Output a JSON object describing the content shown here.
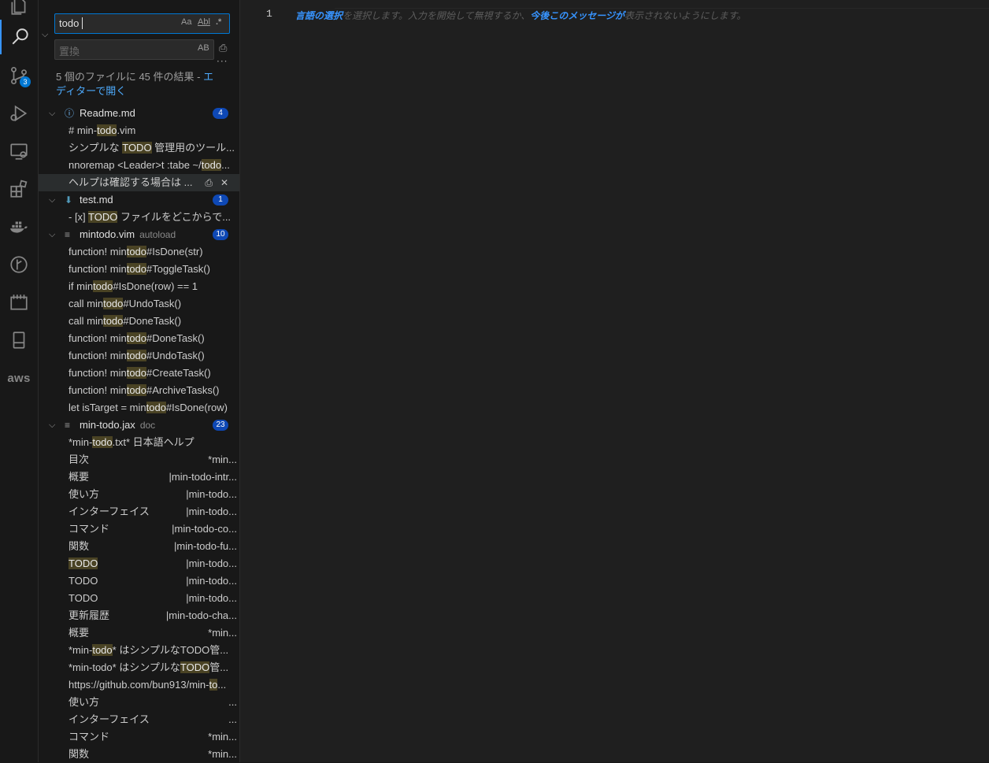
{
  "activity_bar": {
    "source_control_badge": "3",
    "aws_label": "aws"
  },
  "search": {
    "query": "todo",
    "replace_placeholder": "置換",
    "opt_case": "Aa",
    "opt_word": "Abl",
    "opt_regex": ".*",
    "opt_preserve_case": "AB",
    "summary_prefix": "5 個のファイルに 45 件の結果 - ",
    "summary_link": "エディターで開く"
  },
  "files": [
    {
      "name": "Readme.md",
      "dir": "",
      "count": "4",
      "matches": [
        {
          "pre": "# min-",
          "hl": "todo",
          "post": ".vim"
        },
        {
          "pre": "シンプルな ",
          "hl": "TODO",
          "post": " 管理用のツール..."
        },
        {
          "pre": "nnoremap <Leader>t :tabe ~/",
          "hl": "todo",
          "post": "..."
        },
        {
          "pre": "ヘルプは確認する場合は ...",
          "hl": "",
          "post": ""
        }
      ]
    },
    {
      "name": "test.md",
      "dir": "",
      "count": "1",
      "matches": [
        {
          "pre": "- [x] ",
          "hl": "TODO",
          "post": " ファイルをどこからで..."
        }
      ]
    },
    {
      "name": "mintodo.vim",
      "dir": "autoload",
      "count": "10",
      "matches": [
        {
          "pre": "function! min",
          "hl": "todo",
          "post": "#IsDone(str)"
        },
        {
          "pre": "function! min",
          "hl": "todo",
          "post": "#ToggleTask()"
        },
        {
          "pre": "if min",
          "hl": "todo",
          "post": "#IsDone(row) == 1"
        },
        {
          "pre": "call min",
          "hl": "todo",
          "post": "#UndoTask()"
        },
        {
          "pre": "call min",
          "hl": "todo",
          "post": "#DoneTask()"
        },
        {
          "pre": "function! min",
          "hl": "todo",
          "post": "#DoneTask()"
        },
        {
          "pre": "function! min",
          "hl": "todo",
          "post": "#UndoTask()"
        },
        {
          "pre": "function! min",
          "hl": "todo",
          "post": "#CreateTask()"
        },
        {
          "pre": "function! min",
          "hl": "todo",
          "post": "#ArchiveTasks()"
        },
        {
          "pre": "let isTarget = min",
          "hl": "todo",
          "post": "#IsDone(row)"
        }
      ]
    },
    {
      "name": "min-todo.jax",
      "dir": "doc",
      "count": "23",
      "matches": [
        {
          "pre": "*min-",
          "hl": "todo",
          "post": ".txt*       日本語ヘルプ"
        },
        {
          "pre": "目次",
          "right": "*min..."
        },
        {
          "pre": "概要",
          "right": "|min-todo-intr..."
        },
        {
          "pre": "使い方",
          "right": "|min-todo..."
        },
        {
          "pre": "インターフェイス",
          "right": "|min-todo..."
        },
        {
          "pre": "コマンド",
          "right": "|min-todo-co..."
        },
        {
          "pre": "関数",
          "right": "|min-todo-fu..."
        },
        {
          "pre": "",
          "hl": "TODO",
          "post": "",
          "right": "|min-todo..."
        },
        {
          "pre": "TODO",
          "right": "|min-todo..."
        },
        {
          "pre": "TODO",
          "right": "|min-todo..."
        },
        {
          "pre": "更新履歴",
          "right": "|min-todo-cha..."
        },
        {
          "pre": "概要",
          "right": "*min..."
        },
        {
          "pre": "*min-",
          "hl": "todo",
          "post": "* はシンプルなTODO管..."
        },
        {
          "pre": "*min-todo* はシンプルな",
          "hl": "TODO",
          "post": "管..."
        },
        {
          "pre": "https://github.com/bun913/min-",
          "hl": "to",
          "post": "..."
        },
        {
          "pre": "使い方",
          "right": "..."
        },
        {
          "pre": "インターフェイス",
          "right": "..."
        },
        {
          "pre": "コマンド",
          "right": "*min..."
        },
        {
          "pre": "関数",
          "right": "*min..."
        }
      ]
    }
  ],
  "editor": {
    "line_number": "1",
    "hint_part1": "言語の選択",
    "hint_part2": "を選択します。入力を開始して無視するか、",
    "hint_part3": "今後このメッセージが",
    "hint_part4": "表示されないようにします。"
  }
}
